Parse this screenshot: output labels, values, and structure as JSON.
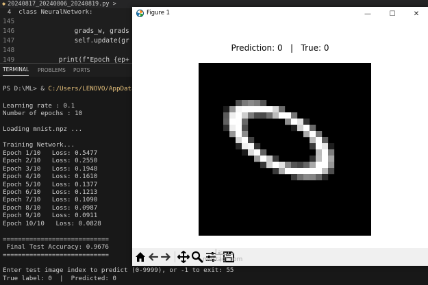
{
  "editor": {
    "tab_label": "20240817_20240806_20240819.py >",
    "breadcrumb": "  4  class NeuralNetwork:",
    "lines": [
      {
        "num": "145",
        "text": ""
      },
      {
        "num": "146",
        "text": "            grads_w, grads"
      },
      {
        "num": "147",
        "text": "            self.update(gr"
      },
      {
        "num": "148",
        "text": ""
      },
      {
        "num": "149",
        "text": "        print(f\"Epoch {ep+"
      }
    ]
  },
  "panel_tabs": [
    "TERMINAL",
    "PROBLEMS",
    "PORTS"
  ],
  "terminal": {
    "prompt": "PS D:\\ML> & ",
    "path": "C:/Users/LENOVO/AppData/Loca",
    "lines": [
      "Learning rate : 0.1",
      "Number of epochs : 10",
      "",
      "Loading mnist.npz ...",
      "",
      "Training Network...",
      "Epoch 1/10   Loss: 0.5477",
      "Epoch 2/10   Loss: 0.2550",
      "Epoch 3/10   Loss: 0.1948",
      "Epoch 4/10   Loss: 0.1610",
      "Epoch 5/10   Loss: 0.1377",
      "Epoch 6/10   Loss: 0.1213",
      "Epoch 7/10   Loss: 0.1090",
      "Epoch 8/10   Loss: 0.0987",
      "Epoch 9/10   Loss: 0.0911",
      "Epoch 10/10   Loss: 0.0828",
      "",
      "============================",
      " Final Test Accuracy: 0.9676",
      "============================",
      "",
      "Enter test image index to predict (0-9999), or -1 to exit: 55",
      "True label: 0  |  Predicted: 0"
    ]
  },
  "figure": {
    "window_title": "Figure 1",
    "controls": {
      "minimize": "—",
      "maximize": "☐",
      "close": "✕"
    },
    "plot_title": "Prediction: 0   |   True: 0",
    "toolbar_icons": [
      "home-icon",
      "back-arrow-icon",
      "forward-arrow-icon",
      "pan-icon",
      "zoom-icon",
      "configure-subplots-icon",
      "save-icon"
    ]
  },
  "watermark": {
    "line1": "مستقل",
    "line2": "mostaql.com"
  },
  "colors": {
    "terminal_bg": "#181818",
    "editor_bg": "#1e1e1e",
    "path_yellow": "#e5c07b",
    "toolbar_bg": "#f0f0f0"
  }
}
